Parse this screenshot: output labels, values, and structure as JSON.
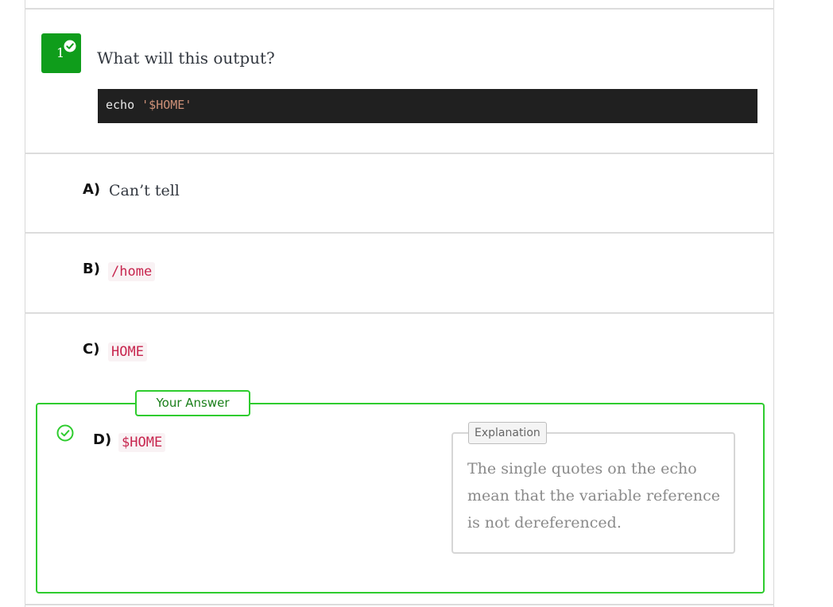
{
  "question": {
    "number": "1",
    "text": "What will this output?",
    "code": {
      "command": "echo",
      "argument": "'$HOME'"
    }
  },
  "options": [
    {
      "letter": "A)",
      "text": "Can’t tell",
      "is_code": false
    },
    {
      "letter": "B)",
      "text": "/home",
      "is_code": true
    },
    {
      "letter": "C)",
      "text": "HOME",
      "is_code": true
    },
    {
      "letter": "D)",
      "text": "$HOME",
      "is_code": true
    }
  ],
  "answer": {
    "label": "Your Answer",
    "explanation_label": "Explanation",
    "explanation": "The single quotes on the echo mean that the variable reference is not dereferenced."
  },
  "colors": {
    "correct_green": "#2ecc2e",
    "badge_green": "#0f9d1b",
    "code_bg": "#202020",
    "inline_code": "#c7254e"
  }
}
